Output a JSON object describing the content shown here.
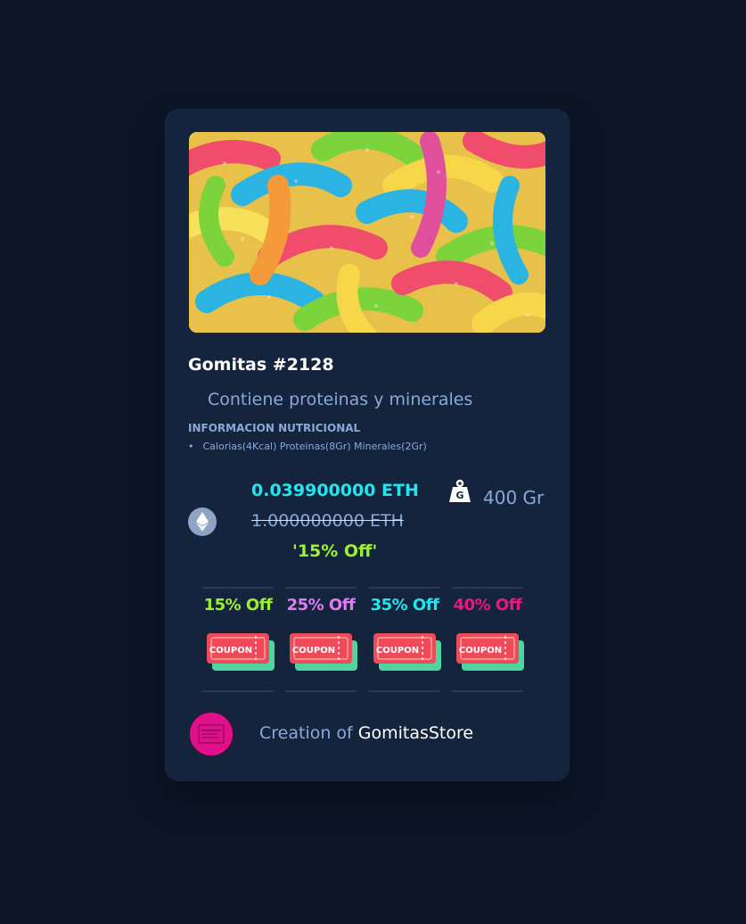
{
  "product": {
    "title": "Gomitas #2128",
    "description": "Contiene proteinas y minerales",
    "nutrition_title": "INFORMACION NUTRICIONAL",
    "nutrition_item": "Calorias(4Kcal) Proteinas(8Gr) Minerales(2Gr)",
    "image_icon": "gummy-worms-photo"
  },
  "pricing": {
    "price": "0.039900000 ETH",
    "old_price": "1.000000000 ETH",
    "discount": "'15% Off'",
    "currency_icon": "ethereum-icon"
  },
  "weight": {
    "value": "400 Gr",
    "icon": "weight-icon"
  },
  "coupons": [
    {
      "label": "15% Off",
      "color": "#9bf22c",
      "ticket_text": "COUPON"
    },
    {
      "label": "25% Off",
      "color": "#e07cf5",
      "ticket_text": "COUPON"
    },
    {
      "label": "35% Off",
      "color": "#21e6f0",
      "ticket_text": "COUPON"
    },
    {
      "label": "40% Off",
      "color": "#f0157f",
      "ticket_text": "COUPON"
    }
  ],
  "creator": {
    "prefix": "Creation of",
    "name": "GomitasStore",
    "avatar_color": "#e0108a"
  },
  "colors": {
    "background": "#0c1627",
    "card": "#15243d",
    "accent_cyan": "#21e6f0",
    "accent_green": "#9bf22c",
    "muted_text": "#8ba8d8"
  }
}
